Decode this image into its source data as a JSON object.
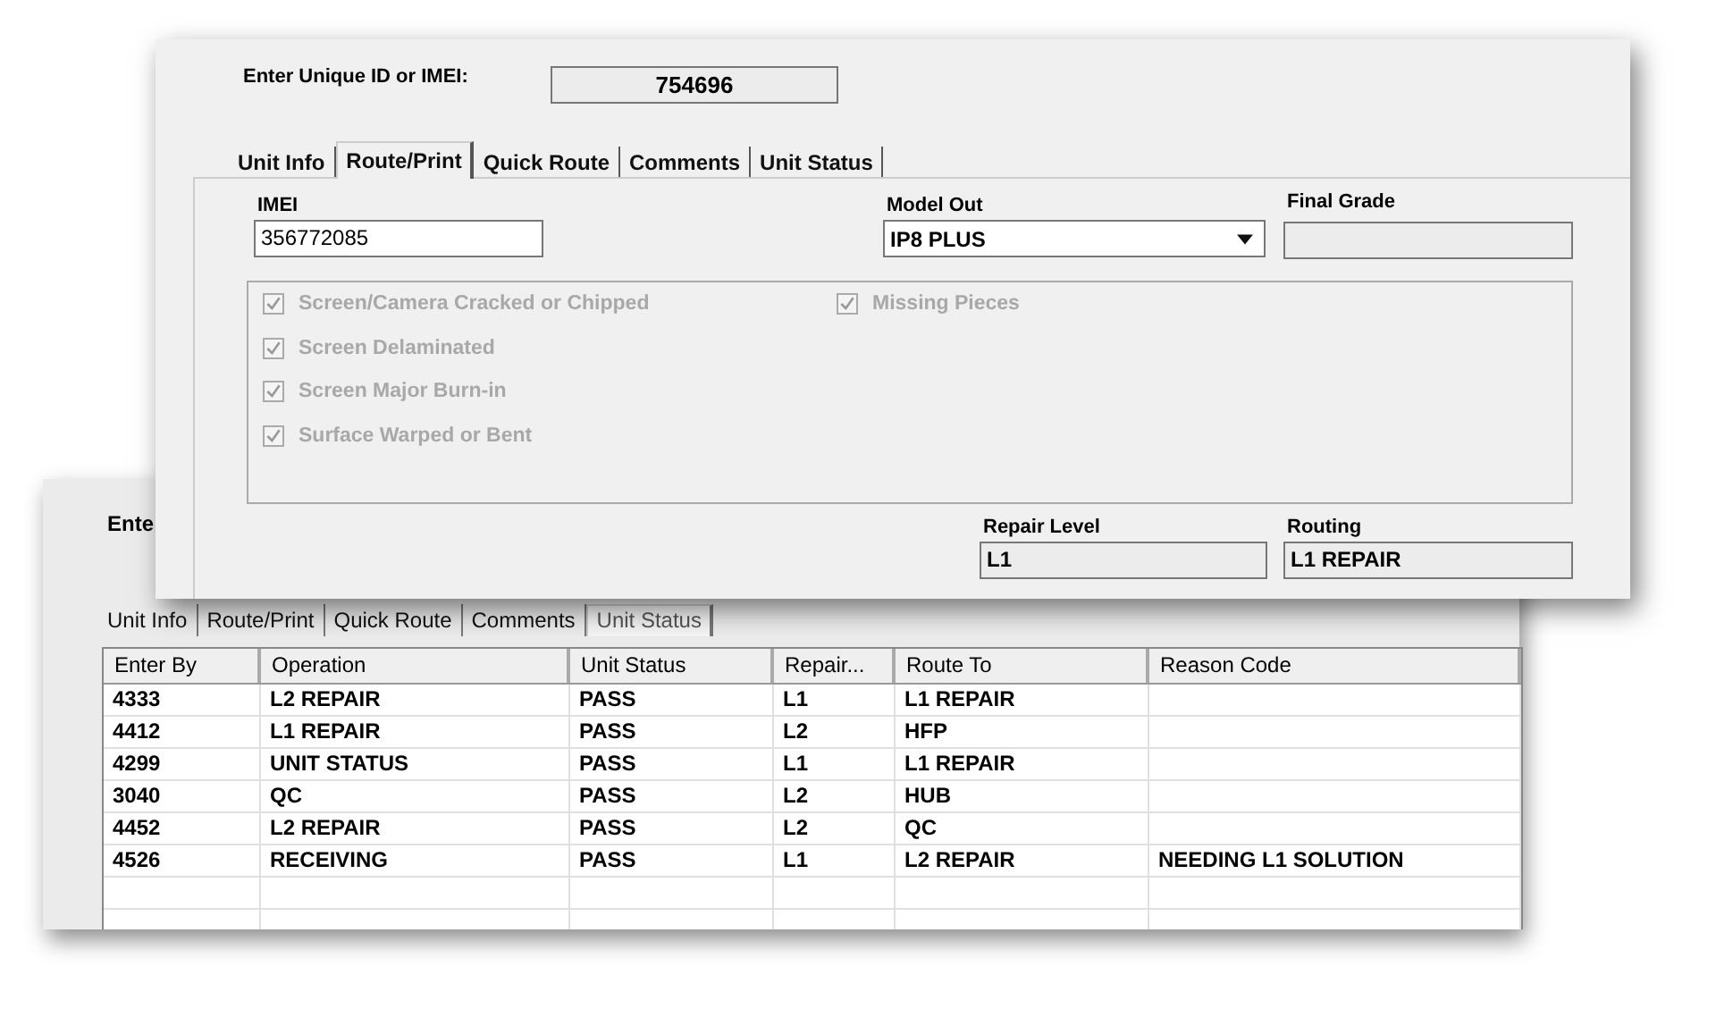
{
  "back_window": {
    "id_label": "Ente",
    "tabs": [
      {
        "label": "Unit Info",
        "selected": false
      },
      {
        "label": "Route/Print",
        "selected": false
      },
      {
        "label": "Quick Route",
        "selected": false
      },
      {
        "label": "Comments",
        "selected": false
      },
      {
        "label": "Unit Status",
        "selected": true
      }
    ],
    "table": {
      "columns": [
        "Enter By",
        "Operation",
        "Unit Status",
        "Repair...",
        "Route To",
        "Reason Code"
      ],
      "rows": [
        [
          "4333",
          "L2 REPAIR",
          "PASS",
          "L1",
          "L1 REPAIR",
          ""
        ],
        [
          "4412",
          "L1 REPAIR",
          "PASS",
          "L2",
          "HFP",
          ""
        ],
        [
          "4299",
          "UNIT STATUS",
          "PASS",
          "L1",
          "L1 REPAIR",
          ""
        ],
        [
          "3040",
          "QC",
          "PASS",
          "L2",
          "HUB",
          ""
        ],
        [
          "4452",
          "L2 REPAIR",
          "PASS",
          "L2",
          "QC",
          ""
        ],
        [
          "4526",
          "RECEIVING",
          "PASS",
          "L1",
          "L2 REPAIR",
          "NEEDING L1 SOLUTION"
        ]
      ]
    }
  },
  "front_window": {
    "id_label": "Enter Unique ID or IMEI:",
    "id_value": "754696",
    "tabs": [
      {
        "label": "Unit Info",
        "selected": false
      },
      {
        "label": "Route/Print",
        "selected": true
      },
      {
        "label": "Quick Route",
        "selected": false
      },
      {
        "label": "Comments",
        "selected": false
      },
      {
        "label": "Unit Status",
        "selected": false
      }
    ],
    "imei": {
      "label": "IMEI",
      "value": "356772085"
    },
    "model_out": {
      "label": "Model Out",
      "value": "IP8 PLUS"
    },
    "final_grade": {
      "label": "Final Grade"
    },
    "checkboxes_left": [
      {
        "label": "Screen/Camera Cracked or Chipped",
        "checked": true,
        "disabled": true
      },
      {
        "label": "Screen Delaminated",
        "checked": true,
        "disabled": true
      },
      {
        "label": "Screen Major Burn-in",
        "checked": true,
        "disabled": true
      },
      {
        "label": "Surface Warped or Bent",
        "checked": true,
        "disabled": true
      }
    ],
    "checkboxes_right": [
      {
        "label": "Missing Pieces",
        "checked": true,
        "disabled": true
      }
    ],
    "repair_level": {
      "label": "Repair Level",
      "value": "L1"
    },
    "routing": {
      "label": "Routing",
      "value": "L1 REPAIR"
    }
  }
}
